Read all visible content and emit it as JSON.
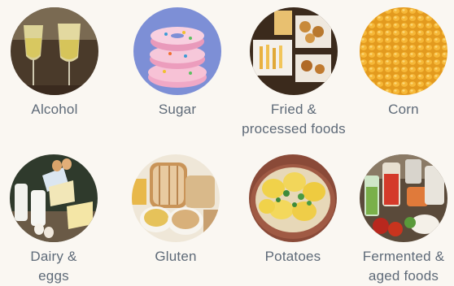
{
  "foods": [
    {
      "id": "alcohol",
      "lines": [
        "Alcohol"
      ]
    },
    {
      "id": "sugar",
      "lines": [
        "Sugar"
      ]
    },
    {
      "id": "fried",
      "lines": [
        "Fried &",
        "processed foods"
      ]
    },
    {
      "id": "corn",
      "lines": [
        "Corn"
      ]
    },
    {
      "id": "dairy",
      "lines": [
        "Dairy &",
        "eggs"
      ]
    },
    {
      "id": "gluten",
      "lines": [
        "Gluten"
      ]
    },
    {
      "id": "potatoes",
      "lines": [
        "Potatoes"
      ]
    },
    {
      "id": "fermented",
      "lines": [
        "Fermented &",
        "aged foods"
      ]
    }
  ]
}
